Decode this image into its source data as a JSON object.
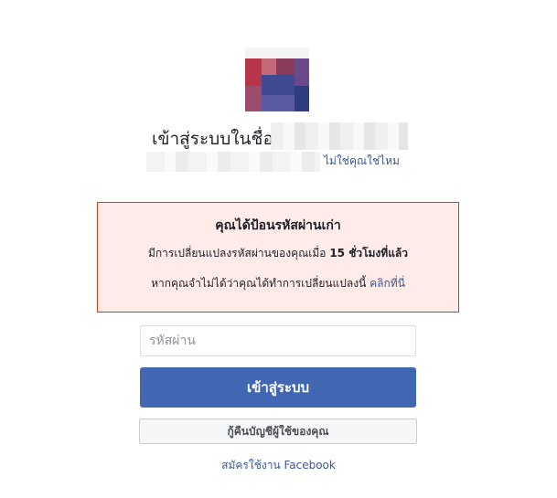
{
  "profile": {
    "login_as_label": "เข้าสู่ระบบในชื่อ",
    "not_you_link": "ไม่ใช่คุณใช่ไหม"
  },
  "alert": {
    "title": "คุณได้ป้อนรหัสผ่านเก่า",
    "changed_prefix": "มีการเปลี่ยนแปลงรหัสผ่านของคุณเมื่อ",
    "changed_time": "15 ชั่วโมงที่แล้ว",
    "not_you_prefix": "หากคุณจำไม่ได้ว่าคุณได้ทำการเปลี่ยนแปลงนี้",
    "click_here_link": "คลิกที่นี่"
  },
  "form": {
    "password_placeholder": "รหัสผ่าน",
    "password_value": "",
    "login_button": "เข้าสู่ระบบ",
    "recover_button": "กู้คืนบัญชีผู้ใช้ของคุณ",
    "signup_link": "สมัครใช้งาน Facebook"
  },
  "colors": {
    "primary": "#4267b2",
    "link": "#385898",
    "alert_bg": "#ffebe8",
    "alert_border": "#dd3c10"
  }
}
